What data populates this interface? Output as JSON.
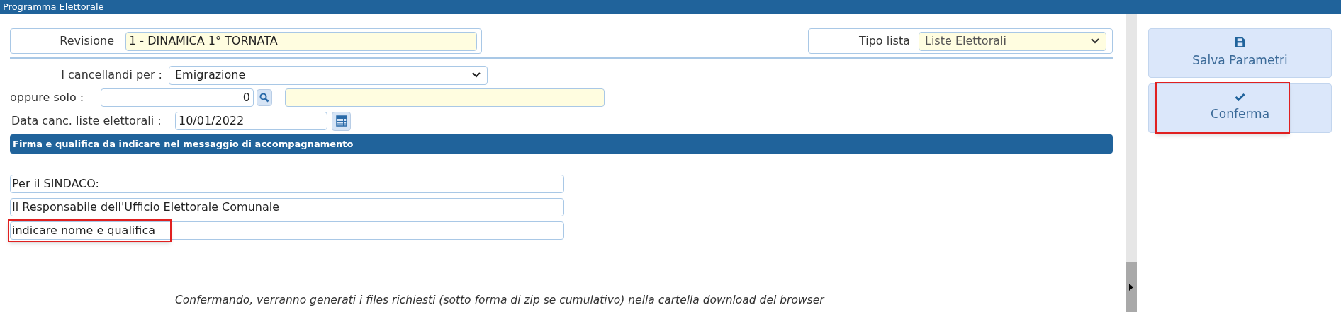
{
  "window": {
    "title": "Programma Elettorale"
  },
  "revisione": {
    "label": "Revisione",
    "value": "1 - DINAMICA 1° TORNATA"
  },
  "tipo_lista": {
    "label": "Tipo lista",
    "value": "Liste Elettorali"
  },
  "cancellandi": {
    "label": "I cancellandi per :",
    "value": "Emigrazione"
  },
  "oppure_solo": {
    "label": "oppure solo :",
    "value": "0"
  },
  "data_canc": {
    "label": "Data canc. liste elettorali :",
    "value": "10/01/2022"
  },
  "section_header": "Firma e qualifica da indicare nel messaggio di accompagnamento",
  "signature_lines": [
    {
      "value": "Per il SINDACO:",
      "highlighted": false
    },
    {
      "value": "Il Responsabile dell'Ufficio Elettorale Comunale",
      "highlighted": false
    },
    {
      "value": "indicare nome e qualifica",
      "highlighted": true
    }
  ],
  "note": "Confermando, verranno generati i files richiesti (sotto forma di zip se cumulativo) nella cartella download del browser",
  "buttons": [
    {
      "kind": "save",
      "label": "Salva Parametri",
      "highlighted": false
    },
    {
      "kind": "confirm",
      "label": "Conferma",
      "highlighted": true
    }
  ]
}
